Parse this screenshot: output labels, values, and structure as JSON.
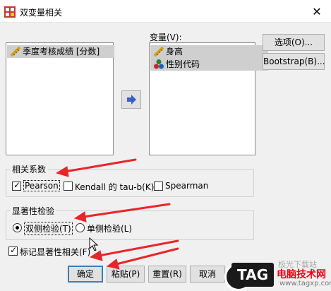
{
  "window": {
    "title": "双变量相关",
    "close_glyph": "✕"
  },
  "source_list": {
    "items": [
      {
        "label": "季度考核成绩 [分数]",
        "icon": "ruler-scale-icon",
        "selected": true
      }
    ]
  },
  "variables": {
    "label": "变量(V):",
    "items": [
      {
        "label": "身高",
        "icon": "ruler-scale-icon",
        "selected": true
      },
      {
        "label": "性别代码",
        "icon": "nominal-balls-icon",
        "selected": true
      }
    ]
  },
  "side_buttons": {
    "options": "选项(O)...",
    "bootstrap": "Bootstrap(B)..."
  },
  "correlation": {
    "legend": "相关系数",
    "pearson": {
      "label": "Pearson",
      "checked": true
    },
    "kendall": {
      "label": "Kendall 的 tau-b(K)",
      "checked": false
    },
    "spearman": {
      "label": "Spearman",
      "checked": false
    }
  },
  "significance": {
    "legend": "显著性检验",
    "two_tailed": {
      "label": "双侧检验(T)",
      "selected": true
    },
    "one_tailed": {
      "label": "单侧检验(L)",
      "selected": false
    }
  },
  "flag": {
    "label": "标记显著性相关(F)",
    "checked": true
  },
  "footer": {
    "ok": "确定",
    "paste": "粘贴(P)",
    "reset": "重置(R)",
    "cancel": "取消"
  },
  "watermark": {
    "tag": "TAG",
    "cn_top": "极光下载站",
    "cn_main": "电脑技术网",
    "url": "www.tagxp.com"
  },
  "colors": {
    "annotation_arrow": "#e8262a",
    "default_button_border": "#3c7fb1",
    "selection": "#cfcfcf"
  }
}
